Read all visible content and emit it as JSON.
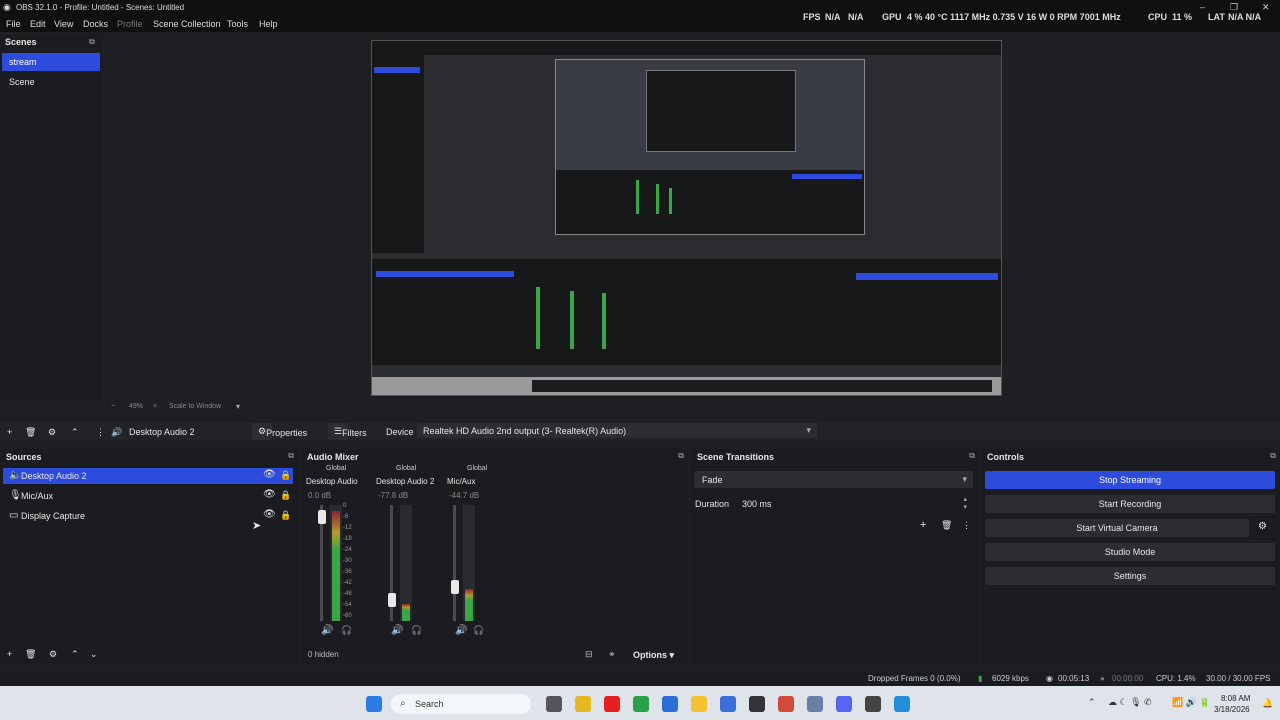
{
  "window": {
    "title": "OBS 32.1.0 - Profile: Untitled - Scenes: Untitled"
  },
  "menu": [
    "File",
    "Edit",
    "View",
    "Docks",
    "Profile",
    "Scene Collection",
    "Tools",
    "Help"
  ],
  "stats": {
    "fps_label": "FPS",
    "fps_value": "N/A",
    "fps_value2": "N/A",
    "gpu_label": "GPU",
    "gpu_value": "4 % 40 °C 1117 MHz 0.735 V 16 W 0 RPM 7001 MHz",
    "cpu_label": "CPU",
    "cpu_value": "11 %",
    "lat_label": "LAT",
    "lat_value": "N/A N/A"
  },
  "scenes": {
    "title": "Scenes",
    "items": [
      "stream",
      "Scene"
    ],
    "selected": 0
  },
  "preview": {
    "zoom": "49%",
    "scale_label": "Scale to Window"
  },
  "source_toolbar": {
    "source_name": "Desktop Audio 2",
    "properties": "Properties",
    "filters": "Filters",
    "device_label": "Device",
    "device_value": "Realtek HD Audio 2nd output (3- Realtek(R) Audio)"
  },
  "sources": {
    "title": "Sources",
    "items": [
      {
        "name": "Desktop Audio 2",
        "icon": "speaker-icon"
      },
      {
        "name": "Mic/Aux",
        "icon": "microphone-icon"
      },
      {
        "name": "Display Capture",
        "icon": "monitor-icon"
      }
    ],
    "selected": 0
  },
  "mixer": {
    "title": "Audio Mixer",
    "hidden": "0 hidden",
    "options": "Options",
    "channels": [
      {
        "global": "Global",
        "name": "Desktop Audio",
        "db": "0.0 dB",
        "level": 0.95
      },
      {
        "global": "Global",
        "name": "Desktop Audio 2",
        "db": "-77.8 dB",
        "level": 0.15
      },
      {
        "global": "Global",
        "name": "Mic/Aux",
        "db": "-44.7 dB",
        "level": 0.28
      }
    ],
    "scale": [
      "0",
      "-6",
      "-12",
      "-18",
      "-24",
      "-30",
      "-36",
      "-42",
      "-48",
      "-54",
      "-60"
    ]
  },
  "transitions": {
    "title": "Scene Transitions",
    "type": "Fade",
    "duration_label": "Duration",
    "duration_value": "300 ms"
  },
  "controls": {
    "title": "Controls",
    "buttons": [
      "Stop Streaming",
      "Start Recording",
      "Start Virtual Camera",
      "Studio Mode",
      "Settings"
    ]
  },
  "status": {
    "dropped": "Dropped Frames 0 (0.0%)",
    "kbps": "6029 kbps",
    "stream_time": "00:05:13",
    "rec_time": "00:00:00",
    "cpu": "CPU: 1.4%",
    "fps": "30.00 / 30.00 FPS"
  },
  "taskbar": {
    "search": "Search",
    "time": "8:08 AM",
    "date": "3/18/2026"
  },
  "colors": {
    "accent": "#2d4bdc",
    "meter_green": "#3aa647"
  }
}
